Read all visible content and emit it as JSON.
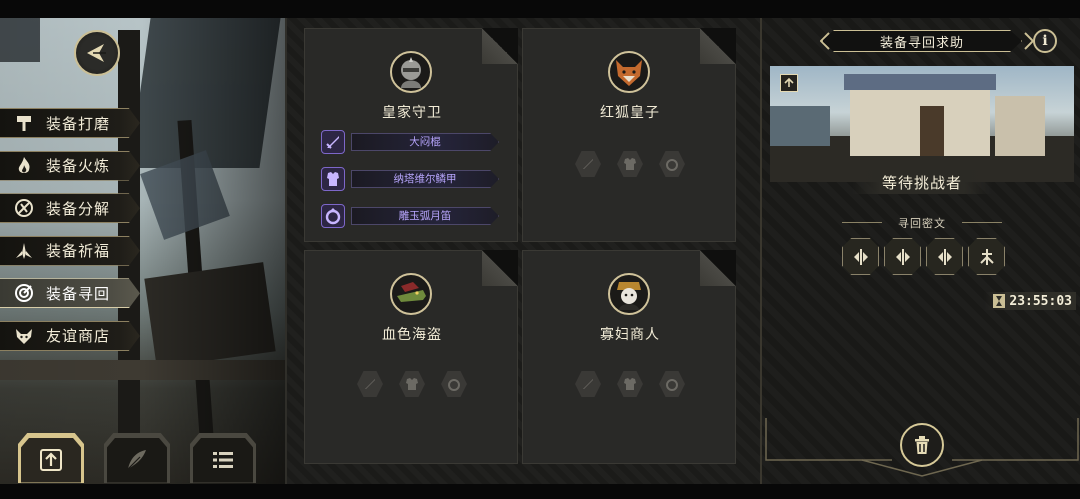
{
  "colors": {
    "gold": "#cbbf95",
    "epic_purple": "#b9a7ff",
    "panel": "#292927"
  },
  "side_menu": [
    {
      "icon": "hammer-icon",
      "label": "装备打磨"
    },
    {
      "icon": "flame-icon",
      "label": "装备火炼"
    },
    {
      "icon": "split-icon",
      "label": "装备分解"
    },
    {
      "icon": "bless-icon",
      "label": "装备祈福"
    },
    {
      "icon": "target-icon",
      "label": "装备寻回"
    },
    {
      "icon": "fox-icon",
      "label": "友谊商店"
    }
  ],
  "cards": [
    {
      "name": "皇家守卫",
      "portrait": "knight-portrait",
      "equipment": [
        {
          "icon": "sword-icon",
          "name": "大闷棍"
        },
        {
          "icon": "armor-icon",
          "name": "纳塔维尔鳞甲"
        },
        {
          "icon": "ring-icon",
          "name": "雕玉弧月笛"
        }
      ]
    },
    {
      "name": "红狐皇子",
      "portrait": "fox-portrait",
      "equipment": []
    },
    {
      "name": "血色海盗",
      "portrait": "croc-portrait",
      "equipment": []
    },
    {
      "name": "寡妇商人",
      "portrait": "widow-portrait",
      "equipment": []
    }
  ],
  "right_panel": {
    "title": "装备寻回求助",
    "info": "i",
    "status": "等待挑战者",
    "cipher_label": "寻回密文",
    "runes": [
      "rune-a-icon",
      "rune-b-icon",
      "rune-c-icon",
      "rune-d-icon"
    ],
    "timer": "23:55:03"
  }
}
